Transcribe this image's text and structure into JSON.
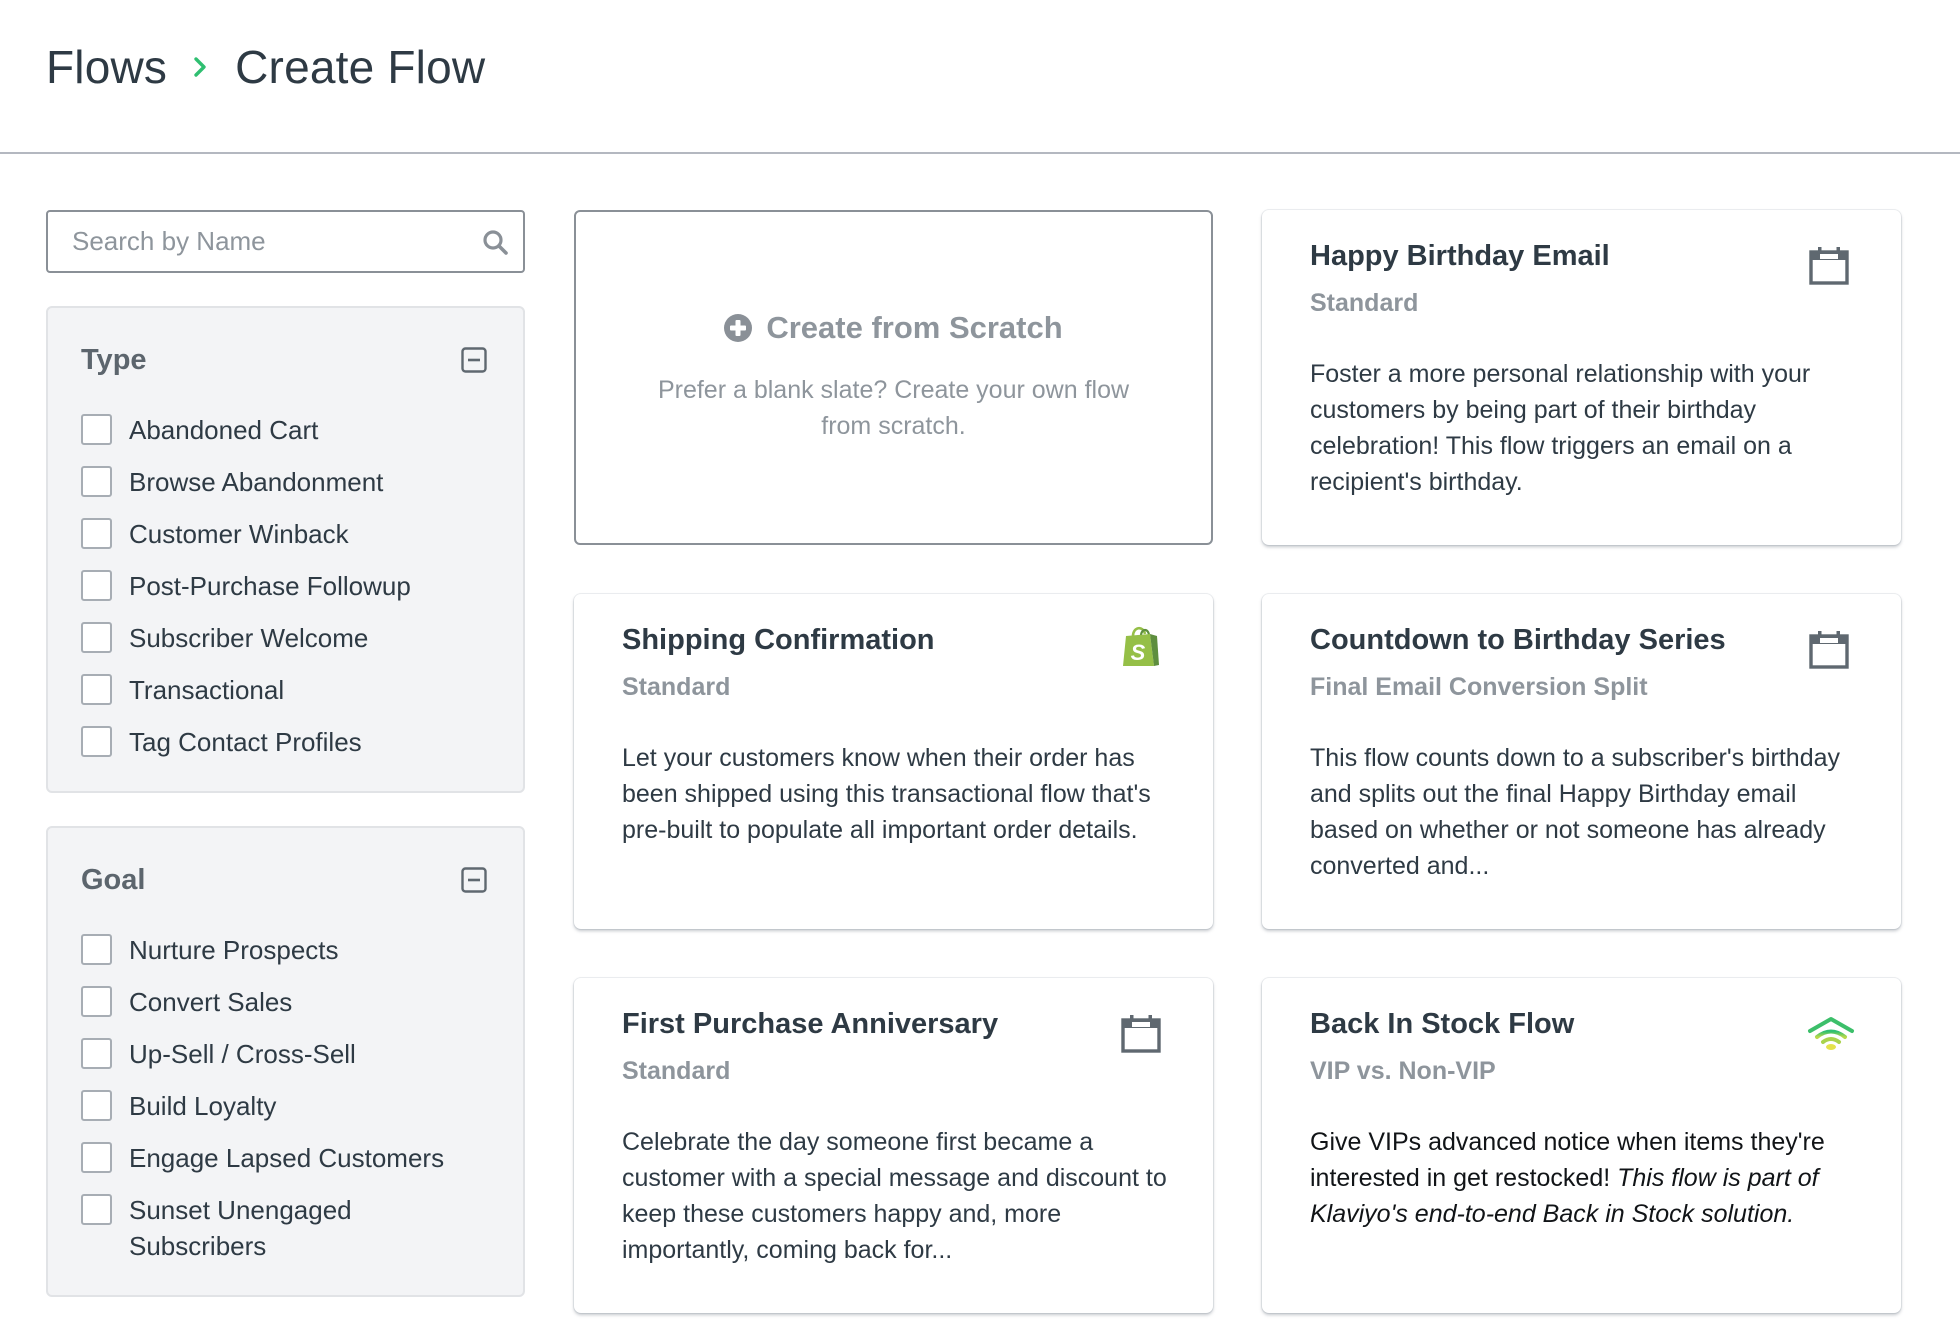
{
  "breadcrumb": {
    "parent": "Flows",
    "current": "Create Flow",
    "separator_icon": "chevron-right-icon",
    "separator_color": "#2fbf71"
  },
  "search": {
    "placeholder": "Search by Name",
    "value": "",
    "icon": "search-icon"
  },
  "filters": {
    "type": {
      "title": "Type",
      "collapse_icon": "collapse-minus-icon",
      "options": [
        {
          "label": "Abandoned Cart",
          "checked": false
        },
        {
          "label": "Browse Abandonment",
          "checked": false
        },
        {
          "label": "Customer Winback",
          "checked": false
        },
        {
          "label": "Post-Purchase Followup",
          "checked": false
        },
        {
          "label": "Subscriber Welcome",
          "checked": false
        },
        {
          "label": "Transactional",
          "checked": false
        },
        {
          "label": "Tag Contact Profiles",
          "checked": false
        }
      ]
    },
    "goal": {
      "title": "Goal",
      "collapse_icon": "collapse-minus-icon",
      "options": [
        {
          "label": "Nurture Prospects",
          "checked": false
        },
        {
          "label": "Convert Sales",
          "checked": false
        },
        {
          "label": "Up-Sell / Cross-Sell",
          "checked": false
        },
        {
          "label": "Build Loyalty",
          "checked": false
        },
        {
          "label": "Engage Lapsed Customers",
          "checked": false
        },
        {
          "label": "Sunset Unengaged Subscribers",
          "checked": false
        }
      ]
    }
  },
  "scratch": {
    "title": "Create from Scratch",
    "description": "Prefer a blank slate? Create your own flow from scratch.",
    "icon": "plus-circle-icon"
  },
  "cards": [
    {
      "title": "Happy Birthday Email",
      "subtitle": "Standard",
      "description": "Foster a more personal relationship with your customers by being part of their birthday celebration! This flow triggers an email on a recipient's birthday.",
      "icon": "calendar-icon"
    },
    {
      "title": "Shipping Confirmation",
      "subtitle": "Standard",
      "description": "Let your customers know when their order has been shipped using this transactional flow that's pre-built to populate all important order details.",
      "icon": "shopify-icon"
    },
    {
      "title": "Countdown to Birthday Series",
      "subtitle": "Final Email Conversion Split",
      "description": "This flow counts down to a subscriber's birthday and splits out the final Happy Birthday email based on whether or not someone has already converted and...",
      "icon": "calendar-icon"
    },
    {
      "title": "First Purchase Anniversary",
      "subtitle": "Standard",
      "description": "Celebrate the day someone first became a customer with a special message and discount to keep these customers happy and, more importantly, coming back for...",
      "icon": "calendar-icon"
    },
    {
      "title": "Back In Stock Flow",
      "subtitle": "VIP vs. Non-VIP",
      "description": "Give VIPs advanced notice when items they're interested in get restocked! ",
      "description_italic": "This flow is part of Klaviyo's end-to-end Back in Stock solution.",
      "icon": "back-in-stock-signal-icon"
    }
  ],
  "colors": {
    "text": "#2e3a44",
    "muted": "#8e959c",
    "panel_bg": "#f3f4f6",
    "accent_green": "#2fbf71",
    "shopify_green": "#95bf47",
    "icon_gray": "#5f6870"
  }
}
